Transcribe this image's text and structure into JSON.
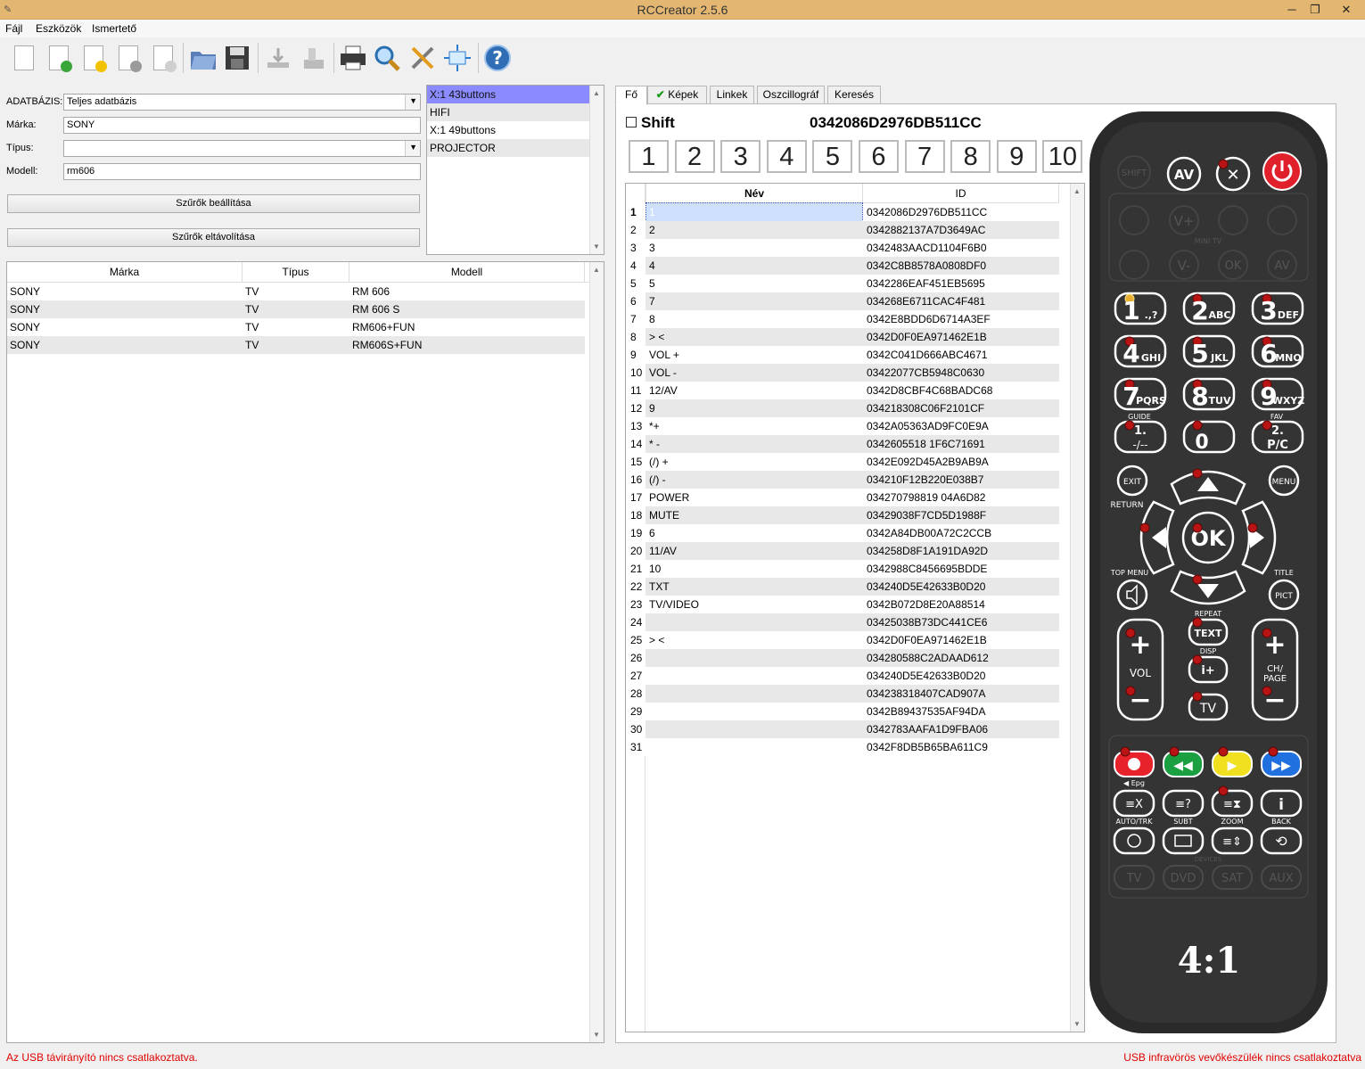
{
  "window": {
    "title": "RCCreator 2.5.6"
  },
  "menu": [
    "Fájl",
    "Eszközök",
    "Ismertető"
  ],
  "toolbar": [
    "new-icon",
    "add-doc-icon",
    "favorite-doc-icon",
    "remove-doc-icon",
    "doc-code-icon",
    "open-folder-icon",
    "save-icon",
    "upload-icon",
    "device-icon",
    "print-icon",
    "search-icon",
    "tools-icon",
    "fit-icon",
    "help-icon"
  ],
  "filters": {
    "db_label": "ADATBÁZIS:",
    "db_value": "Teljes adatbázis",
    "brand_label": "Márka:",
    "brand_value": "SONY",
    "type_label": "Típus:",
    "type_value": "",
    "model_label": "Modell:",
    "model_value": "rm606",
    "apply_btn": "Szűrők beállítása",
    "clear_btn": "Szűrők eltávolítása"
  },
  "type_list": [
    "X:1 43buttons",
    "HIFI",
    "X:1 49buttons",
    "PROJECTOR"
  ],
  "models": {
    "headers": [
      "Márka",
      "Típus",
      "Modell"
    ],
    "rows": [
      [
        "SONY",
        "TV",
        "RM 606"
      ],
      [
        "SONY",
        "TV",
        "RM 606 S"
      ],
      [
        "SONY",
        "TV",
        "RM606+FUN"
      ],
      [
        "SONY",
        "TV",
        "RM606S+FUN"
      ]
    ]
  },
  "tabs": [
    "Fő",
    "Képek",
    "Linkek",
    "Oszcillográf",
    "Keresés"
  ],
  "shift_label": "Shift",
  "code_id": "0342086D2976DB511CC",
  "pages": [
    "1",
    "2",
    "3",
    "4",
    "5",
    "6",
    "7",
    "8",
    "9",
    "10"
  ],
  "buttons_table": {
    "headers": [
      "Név",
      "ID"
    ],
    "rows": [
      [
        "1",
        "1",
        "0342086D2976DB511CC"
      ],
      [
        "2",
        "2",
        "0342882137A7D3649AC"
      ],
      [
        "3",
        "3",
        "0342483AACD1104F6B0"
      ],
      [
        "4",
        "4",
        "0342C8B8578A0808DF0"
      ],
      [
        "5",
        "5",
        "0342286EAF451EB5695"
      ],
      [
        "6",
        "7",
        "034268E6711CAC4F481"
      ],
      [
        "7",
        "8",
        "0342E8BDD6D6714A3EF"
      ],
      [
        "8",
        "> <",
        "0342D0F0EA971462E1B"
      ],
      [
        "9",
        "VOL +",
        "0342C041D666ABC4671"
      ],
      [
        "10",
        "VOL -",
        "03422077CB5948C0630"
      ],
      [
        "11",
        "12/AV",
        "0342D8CBF4C68BADC68"
      ],
      [
        "12",
        "9",
        "034218308C06F2101CF"
      ],
      [
        "13",
        "*+",
        "0342A05363AD9FC0E9A"
      ],
      [
        "14",
        "* -",
        "0342605518 1F6C71691"
      ],
      [
        "15",
        "(/) +",
        "0342E092D45A2B9AB9A"
      ],
      [
        "16",
        "(/) -",
        "034210F12B220E038B7"
      ],
      [
        "17",
        "POWER",
        "034270798819 04A6D82"
      ],
      [
        "18",
        "MUTE",
        "03429038F7CD5D1988F"
      ],
      [
        "19",
        "6",
        "0342A84DB00A72C2CCB"
      ],
      [
        "20",
        "11/AV",
        "034258D8F1A191DA92D"
      ],
      [
        "21",
        "10",
        "0342988C8456695BDDE"
      ],
      [
        "22",
        "TXT",
        "034240D5E42633B0D20"
      ],
      [
        "23",
        "TV/VIDEO",
        "0342B072D8E20A88514"
      ],
      [
        "24",
        "",
        "03425038B73DC441CE6"
      ],
      [
        "25",
        "> <",
        "0342D0F0EA971462E1B"
      ],
      [
        "26",
        "",
        "034280588C2ADAAD612"
      ],
      [
        "27",
        "",
        "034240D5E42633B0D20"
      ],
      [
        "28",
        "",
        "034238318407CAD907A"
      ],
      [
        "29",
        "",
        "0342B89437535AF94DA"
      ],
      [
        "30",
        "",
        "0342783AAFA1D9FBA06"
      ],
      [
        "31",
        "",
        "0342F8DB5B65BA611C9"
      ]
    ]
  },
  "remote": {
    "shift": "SHIFT",
    "av": "AV",
    "mini_tv": "MINI TV",
    "vplus": "V+",
    "vminus": "V-",
    "ok_small": "OK",
    "av2": "AV",
    "digits": [
      [
        "1",
        ".,?"
      ],
      [
        "2",
        "ABC"
      ],
      [
        "3",
        "DEF"
      ],
      [
        "4",
        "GHI"
      ],
      [
        "5",
        "JKL"
      ],
      [
        "6",
        "MNO"
      ],
      [
        "7",
        "PQRS"
      ],
      [
        "8",
        "TUV"
      ],
      [
        "9",
        "WXYZ"
      ]
    ],
    "guide": "GUIDE",
    "fav": "FAV",
    "k1": "1.",
    "k1sub": "-/--",
    "k0": "0",
    "k2": "2.",
    "k2sub": "P/C",
    "exit": "EXIT",
    "menu": "MENU",
    "return": "RETURN",
    "ok": "OK",
    "topmenu": "TOP MENU",
    "title": "TITLE",
    "pict": "PICT",
    "repeat": "REPEAT",
    "text": "TEXT",
    "disp": "DISP",
    "vol": "VOL",
    "ch": "CH/",
    "page": "PAGE",
    "tv": "TV",
    "epg": "◀ Epg",
    "autotrk": "AUTO/TRK",
    "subt": "SUBT",
    "zoom": "ZOOM",
    "back": "BACK",
    "devices": "DEVICES",
    "dev": [
      "TV",
      "DVD",
      "SAT",
      "AUX"
    ],
    "brand": "4:1"
  },
  "status": {
    "left": "Az USB távirányító nincs csatlakoztatva.",
    "right": "USB infravörös vevőkészülék nincs csatlakoztatva"
  }
}
